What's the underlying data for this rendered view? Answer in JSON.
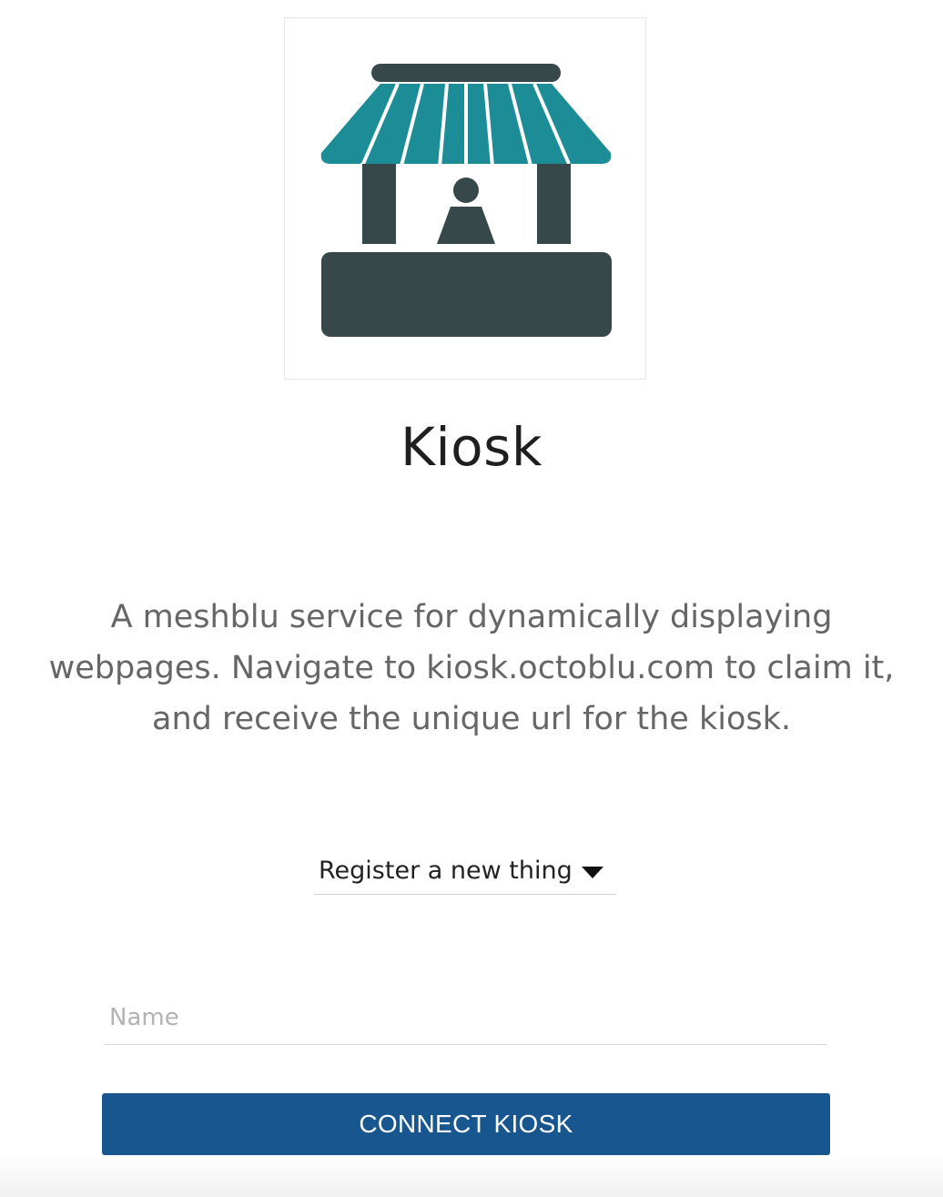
{
  "app": {
    "logo_icon": "kiosk-stand-icon",
    "title": "Kiosk",
    "description": "A meshblu service for dynamically displaying webpages. Navigate to kiosk.octoblu.com to claim it, and receive the unique url for the kiosk."
  },
  "form": {
    "thing_select": {
      "selected": "Register a new thing",
      "icon": "caret-down-icon"
    },
    "name_input": {
      "value": "",
      "placeholder": "Name"
    },
    "connect_label": "CONNECT KIOSK"
  },
  "colors": {
    "awning_teal": "#1c8c97",
    "kiosk_dark": "#37484a",
    "button_blue": "#17568f"
  }
}
